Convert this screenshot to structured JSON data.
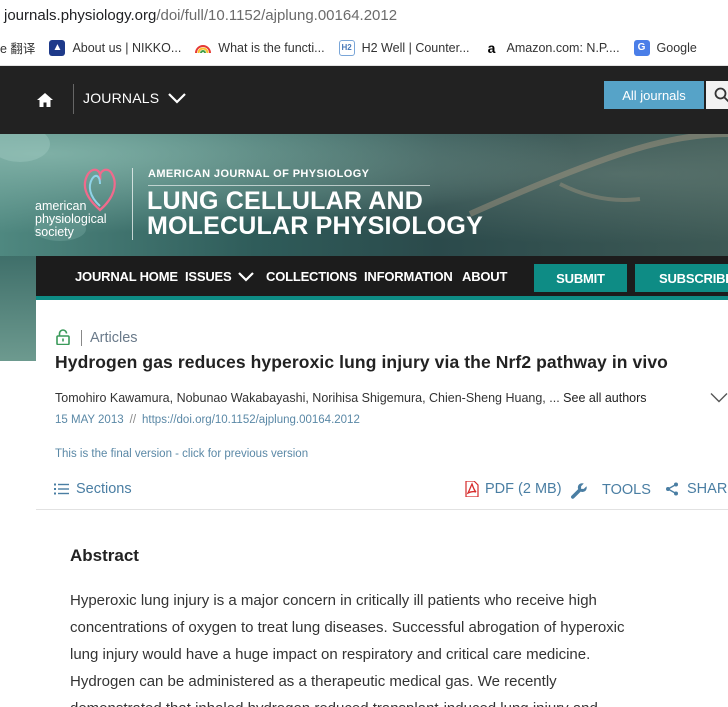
{
  "browser": {
    "url_host": "journals.physiology.org",
    "url_path": "/doi/full/10.1152/ajplung.00164.2012",
    "bookmarks": [
      {
        "label": "e 翻译",
        "icon": "translate-icon",
        "color": "#ffffff"
      },
      {
        "label": "About us | NIKKO...",
        "icon": "nikko-icon",
        "color": "#1e3a8a"
      },
      {
        "label": "What is the functi...",
        "icon": "rainbow-icon",
        "color": "#e85d2a"
      },
      {
        "label": "H2 Well | Counter...",
        "icon": "h2well-icon",
        "color": "#7aa6d8"
      },
      {
        "label": "Amazon.com: N.P....",
        "icon": "amazon-icon",
        "color": "#000000"
      },
      {
        "label": "Google",
        "icon": "google-translate-icon",
        "color": "#4a7ee8"
      }
    ]
  },
  "site_nav": {
    "home_icon": "home-icon",
    "journals_label": "JOURNALS",
    "all_journals_label": "All journals",
    "search_icon": "search-icon"
  },
  "banner": {
    "society_line1": "american",
    "society_line2": "physiological",
    "society_line3": "society",
    "journal_small": "AMERICAN JOURNAL OF PHYSIOLOGY",
    "journal_line1": "LUNG CELLULAR AND",
    "journal_line2": "MOLECULAR PHYSIOLOGY"
  },
  "journal_nav": {
    "items": [
      "JOURNAL HOME",
      "ISSUES",
      "COLLECTIONS",
      "INFORMATION",
      "ABOUT"
    ],
    "submit_label": "SUBMIT",
    "subscribe_label": "SUBSCRIBE",
    "accent_color": "#0e8c85"
  },
  "article": {
    "category": "Articles",
    "title": "Hydrogen gas reduces hyperoxic lung injury via the Nrf2 pathway in vivo",
    "authors": "Tomohiro Kawamura, Nobunao Wakabayashi, Norihisa Shigemura, Chien-Sheng Huang, ...",
    "see_all_authors": "See all authors",
    "date": "15 MAY 2013",
    "date_separator": "//",
    "doi": "https://doi.org/10.1152/ajplung.00164.2012",
    "version_note": "This is the final version - click for previous version",
    "sections_label": "Sections",
    "pdf_label": "PDF (2 MB)",
    "tools_label": "TOOLS",
    "share_label": "SHARE"
  },
  "abstract": {
    "heading": "Abstract",
    "lines": [
      "Hyperoxic lung injury is a major concern in critically ill patients who receive high",
      "concentrations of oxygen to treat lung diseases. Successful abrogation of hyperoxic",
      "lung injury would have a huge impact on respiratory and critical care medicine.",
      "Hydrogen can be administered as a therapeutic medical gas. We recently",
      "demonstrated that inhaled hydrogen reduced transplant-induced lung injury and"
    ]
  }
}
